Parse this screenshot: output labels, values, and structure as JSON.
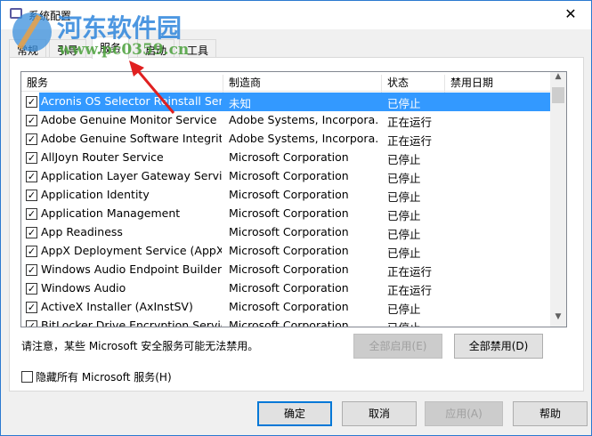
{
  "window": {
    "title": "系统配置",
    "close": "✕"
  },
  "tabs": [
    "常规",
    "引导",
    "服务",
    "启动",
    "工具"
  ],
  "columns": [
    "服务",
    "制造商",
    "状态",
    "禁用日期"
  ],
  "rows": [
    {
      "name": "Acronis OS Selector Reinstall Ser...",
      "maker": "未知",
      "status": "已停止",
      "checked": true,
      "selected": true
    },
    {
      "name": "Adobe Genuine Monitor Service",
      "maker": "Adobe Systems, Incorpora...",
      "status": "正在运行",
      "checked": true
    },
    {
      "name": "Adobe Genuine Software Integrit...",
      "maker": "Adobe Systems, Incorpora...",
      "status": "正在运行",
      "checked": true
    },
    {
      "name": "AllJoyn Router Service",
      "maker": "Microsoft Corporation",
      "status": "已停止",
      "checked": true
    },
    {
      "name": "Application Layer Gateway Service",
      "maker": "Microsoft Corporation",
      "status": "已停止",
      "checked": true
    },
    {
      "name": "Application Identity",
      "maker": "Microsoft Corporation",
      "status": "已停止",
      "checked": true
    },
    {
      "name": "Application Management",
      "maker": "Microsoft Corporation",
      "status": "已停止",
      "checked": true
    },
    {
      "name": "App Readiness",
      "maker": "Microsoft Corporation",
      "status": "已停止",
      "checked": true
    },
    {
      "name": "AppX Deployment Service (AppX...",
      "maker": "Microsoft Corporation",
      "status": "已停止",
      "checked": true
    },
    {
      "name": "Windows Audio Endpoint Builder",
      "maker": "Microsoft Corporation",
      "status": "正在运行",
      "checked": true
    },
    {
      "name": "Windows Audio",
      "maker": "Microsoft Corporation",
      "status": "正在运行",
      "checked": true
    },
    {
      "name": "ActiveX Installer (AxInstSV)",
      "maker": "Microsoft Corporation",
      "status": "已停止",
      "checked": true
    },
    {
      "name": "BitLocker Drive Encryption Service",
      "maker": "Microsoft Corporation",
      "status": "已停止",
      "checked": true
    }
  ],
  "note": "请注意，某些 Microsoft 安全服务可能无法禁用。",
  "enable_all": "全部启用(E)",
  "disable_all": "全部禁用(D)",
  "hide_ms": "隐藏所有 Microsoft 服务(H)",
  "buttons": {
    "ok": "确定",
    "cancel": "取消",
    "apply": "应用(A)",
    "help": "帮助"
  },
  "watermark": {
    "name": "河东软件园",
    "url": "www.pc0359.cn"
  }
}
